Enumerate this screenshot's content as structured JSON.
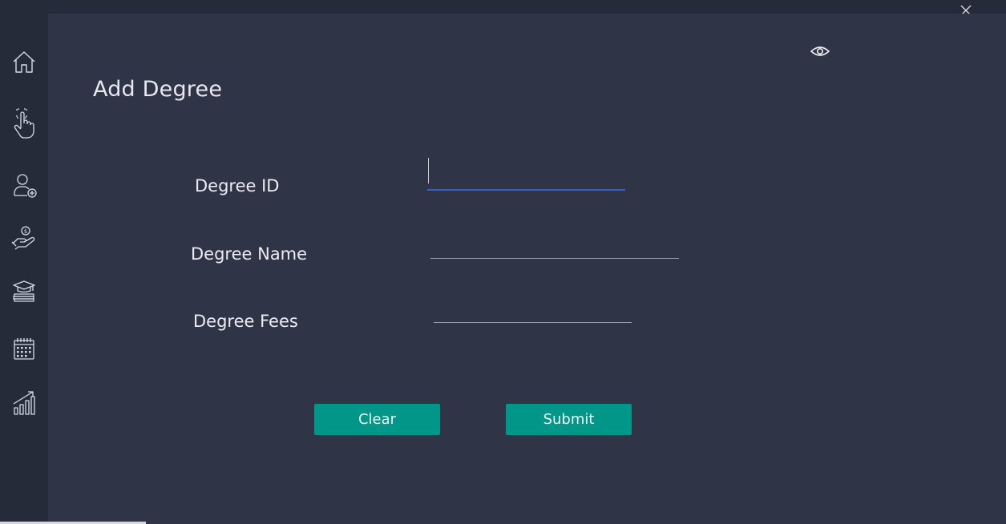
{
  "window": {
    "title_icon_close": "close-icon",
    "colors": {
      "frame": "#252b38",
      "content": "#2f3447",
      "accent": "#009688",
      "focus_underline": "#3a5fcd"
    }
  },
  "sidebar": {
    "items": [
      {
        "name": "home",
        "icon": "home-icon"
      },
      {
        "name": "touch",
        "icon": "hand-touch-icon"
      },
      {
        "name": "add-user",
        "icon": "user-add-icon"
      },
      {
        "name": "payment",
        "icon": "hand-money-icon"
      },
      {
        "name": "degree",
        "icon": "graduation-books-icon"
      },
      {
        "name": "calendar",
        "icon": "calendar-icon"
      },
      {
        "name": "reports",
        "icon": "bar-chart-growth-icon"
      }
    ]
  },
  "form": {
    "title": "Add Degree",
    "fields": [
      {
        "label": "Degree ID",
        "value": ""
      },
      {
        "label": "Degree Name",
        "value": ""
      },
      {
        "label": "Degree Fees",
        "value": ""
      }
    ],
    "clear_label": "Clear",
    "submit_label": "Submit",
    "view_icon": "eye-icon"
  }
}
